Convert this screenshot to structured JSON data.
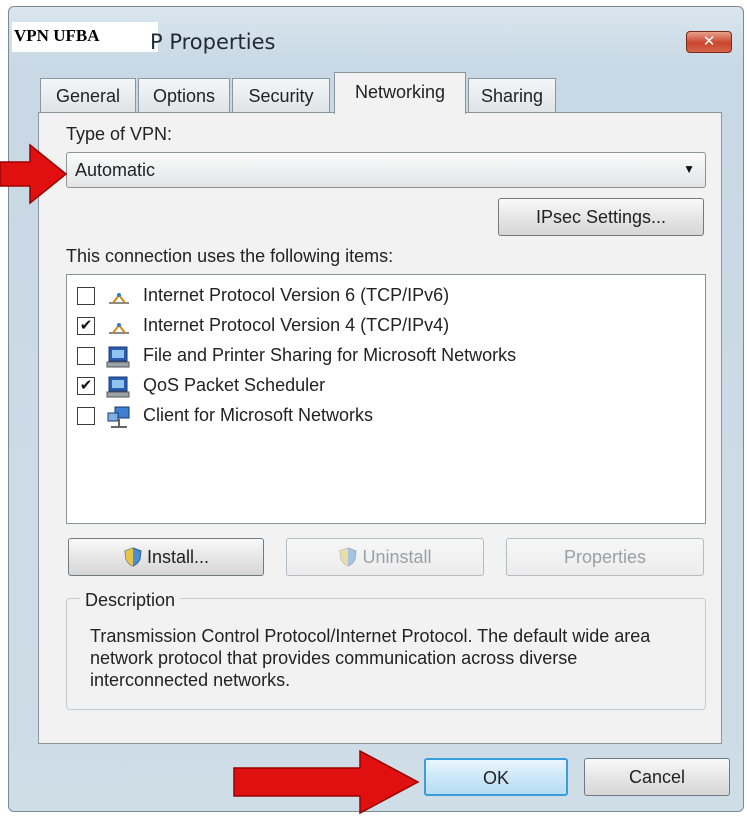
{
  "window": {
    "title_overlay": "VPN UFBA",
    "title": "P Properties",
    "close_glyph": "✕"
  },
  "tabs": [
    {
      "label": "General",
      "active": false
    },
    {
      "label": "Options",
      "active": false
    },
    {
      "label": "Security",
      "active": false
    },
    {
      "label": "Networking",
      "active": true
    },
    {
      "label": "Sharing",
      "active": false
    }
  ],
  "networking": {
    "vpn_type_label": "Type of VPN:",
    "vpn_type_value": "Automatic",
    "ipsec_button": "IPsec Settings...",
    "items_label": "This connection uses the following items:",
    "items": [
      {
        "label": "Internet Protocol Version 6 (TCP/IPv6)",
        "checked": false,
        "check_glyph": "",
        "icon": "network-protocol-icon"
      },
      {
        "label": "Internet Protocol Version 4 (TCP/IPv4)",
        "checked": true,
        "check_glyph": "✔",
        "icon": "network-protocol-icon"
      },
      {
        "label": "File and Printer Sharing for Microsoft Networks",
        "checked": false,
        "check_glyph": "",
        "icon": "network-service-icon"
      },
      {
        "label": "QoS Packet Scheduler",
        "checked": true,
        "check_glyph": "✔",
        "icon": "network-service-icon"
      },
      {
        "label": "Client for Microsoft Networks",
        "checked": false,
        "check_glyph": "",
        "icon": "network-client-icon"
      }
    ],
    "install_button": "Install...",
    "uninstall_button": "Uninstall",
    "properties_button": "Properties",
    "description_legend": "Description",
    "description_text": "Transmission Control Protocol/Internet Protocol. The default wide area network protocol that provides communication across diverse interconnected networks."
  },
  "footer": {
    "ok_button": "OK",
    "cancel_button": "Cancel"
  },
  "colors": {
    "annotation_arrow": "#e01010",
    "ok_button_border": "#3b9ed8"
  }
}
